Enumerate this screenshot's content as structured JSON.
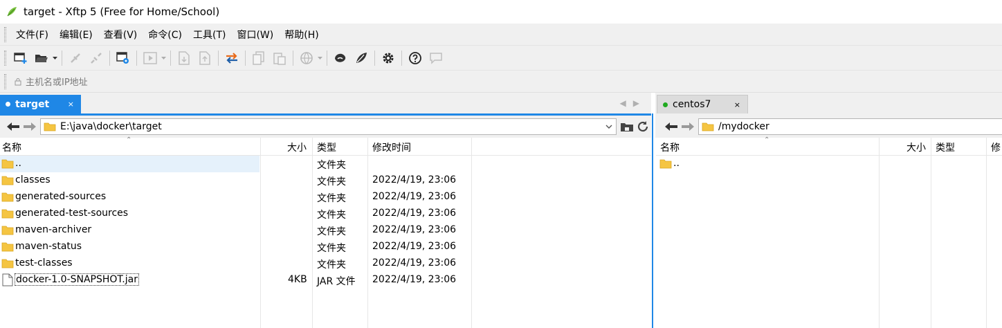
{
  "window": {
    "title": "target - Xftp 5 (Free for Home/School)"
  },
  "menu": [
    "文件(F)",
    "编辑(E)",
    "查看(V)",
    "命令(C)",
    "工具(T)",
    "窗口(W)",
    "帮助(H)"
  ],
  "address": {
    "placeholder": "主机名或IP地址"
  },
  "local": {
    "tab_label": "target",
    "tab_close": "×",
    "path": "E:\\java\\docker\\target",
    "columns": {
      "name": "名称",
      "size": "大小",
      "type": "类型",
      "modified": "修改时间"
    },
    "rows": [
      {
        "name": "..",
        "size": "",
        "type": "文件夹",
        "modified": ""
      },
      {
        "name": "classes",
        "size": "",
        "type": "文件夹",
        "modified": "2022/4/19, 23:06"
      },
      {
        "name": "generated-sources",
        "size": "",
        "type": "文件夹",
        "modified": "2022/4/19, 23:06"
      },
      {
        "name": "generated-test-sources",
        "size": "",
        "type": "文件夹",
        "modified": "2022/4/19, 23:06"
      },
      {
        "name": "maven-archiver",
        "size": "",
        "type": "文件夹",
        "modified": "2022/4/19, 23:06"
      },
      {
        "name": "maven-status",
        "size": "",
        "type": "文件夹",
        "modified": "2022/4/19, 23:06"
      },
      {
        "name": "test-classes",
        "size": "",
        "type": "文件夹",
        "modified": "2022/4/19, 23:06"
      },
      {
        "name": "docker-1.0-SNAPSHOT.jar",
        "size": "4KB",
        "type": "JAR 文件",
        "modified": "2022/4/19, 23:06"
      }
    ]
  },
  "remote": {
    "tab_label": "centos7",
    "tab_close": "×",
    "path": "/mydocker",
    "columns": {
      "name": "名称",
      "size": "大小",
      "type": "类型",
      "modified": "修"
    },
    "rows": [
      {
        "name": ".."
      }
    ]
  },
  "colors": {
    "accent": "#1f87e6",
    "folder": "#f5c542",
    "connected": "#1faa1f"
  }
}
